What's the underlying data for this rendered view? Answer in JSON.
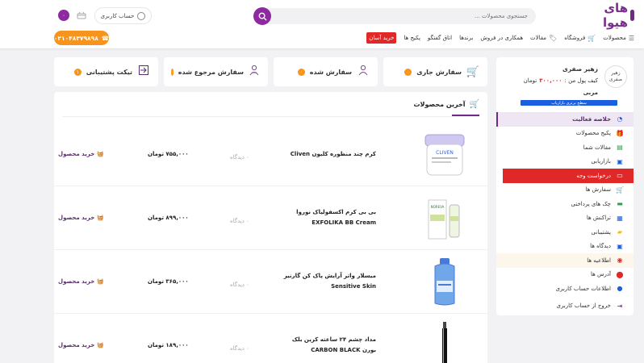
{
  "header": {
    "logo_text": "های هیوا",
    "search_placeholder": "جستجوی محصولات ...",
    "account_label": "حساب کاربری",
    "cart_badge": "۰",
    "phone": "۰۲۱۰۴۸۳۷۹۸۹۸"
  },
  "nav": {
    "items": [
      {
        "label": "محصولات",
        "icon": "menu-icon"
      },
      {
        "label": "فروشگاه",
        "icon": "cart-icon"
      },
      {
        "label": "مقالات",
        "icon": "tag-icon"
      },
      {
        "label": "همکاری در فروش",
        "icon": ""
      },
      {
        "label": "برندها",
        "icon": ""
      },
      {
        "label": "اتاق گفتگو",
        "icon": ""
      },
      {
        "label": "پکیج ها",
        "icon": ""
      }
    ],
    "easy_buy": "خرید آسان"
  },
  "stats": [
    {
      "label": "سفارش جاری",
      "count": "۰",
      "icon": "cart-icon"
    },
    {
      "label": "سفارش شده",
      "count": "۰",
      "icon": "user-check-icon"
    },
    {
      "label": "سفارش مرجوع شده",
      "count": "۰",
      "icon": "user-return-icon"
    },
    {
      "label": "تیکت پشتیبانی",
      "count": "۱",
      "icon": "login-icon"
    }
  ],
  "profile": {
    "avatar_text": "زهیر صفری",
    "name": "زهیر صفری",
    "wallet_label": "کیف پول من :",
    "wallet_amount": "۳۰۰,۰۰۰",
    "wallet_unit": "تومان",
    "role": "مربی",
    "level": "سطح برنزی بازاریاب"
  },
  "menu": [
    {
      "label": "خلاصه فعالیت",
      "icon": "dashboard-icon",
      "state": "active"
    },
    {
      "label": "پکیج محصولات",
      "icon": "gift-icon",
      "state": ""
    },
    {
      "label": "مقالات شما",
      "icon": "article-icon",
      "state": ""
    },
    {
      "label": "بازاریابی",
      "icon": "marketing-icon",
      "state": ""
    },
    {
      "label": "درخواست وجه",
      "icon": "money-icon",
      "state": "hilite"
    },
    {
      "label": "سفارش ها",
      "icon": "cart-icon",
      "state": ""
    },
    {
      "label": "چک های پرداختی",
      "icon": "check-icon",
      "state": ""
    },
    {
      "label": "تراکنش ها",
      "icon": "transaction-icon",
      "state": ""
    },
    {
      "label": "پشتیبانی",
      "icon": "support-icon",
      "state": ""
    },
    {
      "label": "دیدگاه ها",
      "icon": "comment-icon",
      "state": ""
    },
    {
      "label": "اطلاعیه ها",
      "icon": "notification-icon",
      "state": "soft"
    },
    {
      "label": "آدرس ها",
      "icon": "location-icon",
      "state": ""
    },
    {
      "label": "اطلاعات حساب کاربری",
      "icon": "user-icon",
      "state": ""
    },
    {
      "label": "خروج از حساب کاربری",
      "icon": "logout-icon",
      "state": ""
    }
  ],
  "latest": {
    "title": "آخرین محصولات",
    "products": [
      {
        "name": "کرم چند منظوره کلیون Cliven",
        "views": "۰ دیدگاه",
        "price": "۷۵۵,۰۰۰ تومان",
        "buy": "خرید محصول",
        "img": "jar"
      },
      {
        "name": "بی بی کرم اکسفولیاک نوروا EXFOLIKA BB Cream",
        "views": "۰ دیدگاه",
        "price": "۸۹۹,۰۰۰ تومان",
        "buy": "خرید محصول",
        "img": "tube"
      },
      {
        "name": "میسلار واتر آرایش پاک کن گارنیر Sensitive Skin",
        "views": "۰ دیدگاه",
        "price": "۳۶۵,۰۰۰ تومان",
        "buy": "خرید محصول",
        "img": "bottle"
      },
      {
        "name": "مداد چشم ۲۴ ساعته کرین بلک بورن CARBON BLACK",
        "views": "۰ دیدگاه",
        "price": "۱۸۹,۰۰۰ تومان",
        "buy": "خرید محصول",
        "img": "pencil"
      }
    ]
  }
}
